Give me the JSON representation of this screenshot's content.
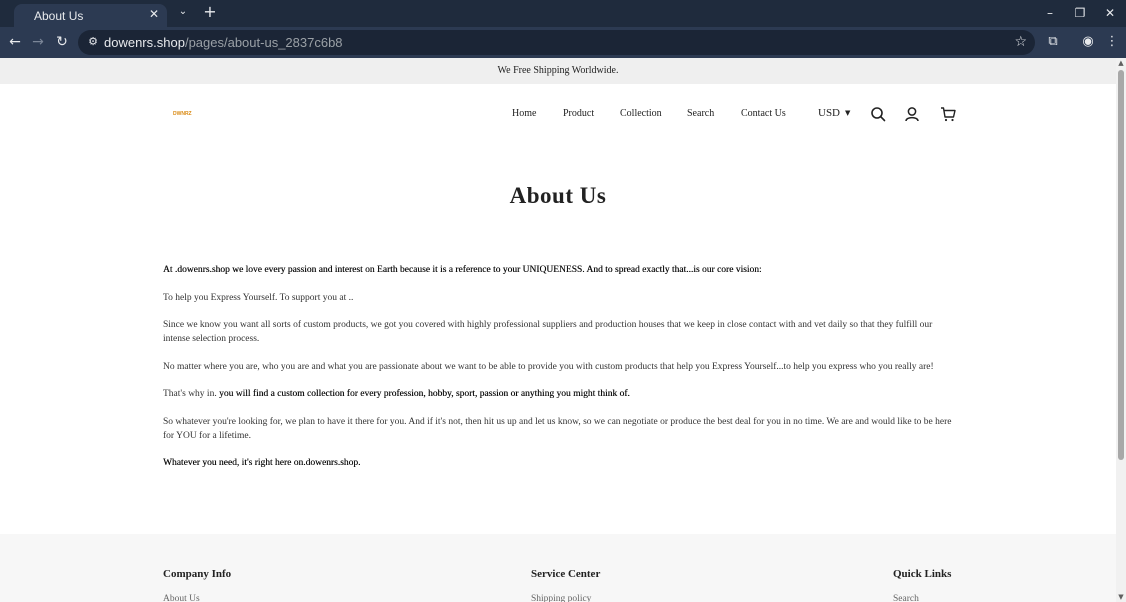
{
  "browser": {
    "tab_title": "About Us",
    "tab_close": "✕",
    "tab_menu": "⌄",
    "new_tab": "+",
    "url_host": "dowenrs.shop",
    "url_path": "/pages/about-us_2837c6b8",
    "window_controls": {
      "minimize": "–",
      "restore": "❐",
      "close": "✕"
    },
    "nav": {
      "back": "←",
      "forward": "→",
      "reload": "↻"
    },
    "icons": {
      "site_info": "site-info-icon",
      "bookmark": "star-icon",
      "extensions": "puzzle-icon",
      "profile": "account-icon",
      "menu": "kebab-menu-icon"
    },
    "glyphs": {
      "site_info": "⚙",
      "bookmark": "☆",
      "extensions": "⧉",
      "profile": "◉",
      "menu": "⋮"
    }
  },
  "announcement": "We Free Shipping Worldwide.",
  "header": {
    "logo_text": "DWNRZ",
    "nav": [
      {
        "label": "Home"
      },
      {
        "label": "Product"
      },
      {
        "label": "Collection"
      },
      {
        "label": "Search"
      },
      {
        "label": "Contact Us"
      }
    ],
    "currency": "USD",
    "currency_caret": "▼"
  },
  "page": {
    "title": "About Us",
    "paragraphs": [
      "At .dowenrs.shop we love every passion and interest on Earth because it is a reference to your UNIQUENESS. And to spread exactly that...is our core vision:",
      "To help you Express Yourself. To support you at ..",
      "Since we know you want all sorts of custom products, we got you covered with highly professional suppliers and production houses that we keep in close contact with and vet daily so that they fulfill our intense selection process.",
      "No matter where you are, who you are and what you are passionate about we want to be able to provide you with custom products that help you Express Yourself...to help you express who you really are!",
      "That's why in. ",
      "you will find a custom collection for every profession, hobby, sport, passion or anything you might think of.",
      "So whatever you're looking for, we plan to have it there for you. And if it's not, then hit us up and let us know, so we can negotiate or produce the best deal for you in no time. We are and would like to be here for YOU for a lifetime.",
      "Whatever you need, it's right here on.dowenrs.shop."
    ]
  },
  "footer": {
    "columns": [
      {
        "heading": "Company Info",
        "first_link": "About Us"
      },
      {
        "heading": "Service Center",
        "first_link": "Shipping policy"
      },
      {
        "heading": "Quick Links",
        "first_link": "Search"
      }
    ]
  },
  "scrollbar": {
    "up": "▲",
    "down": "▼"
  },
  "colors": {
    "tabbar": "#1f2b3d",
    "toolbar": "#2c3a52",
    "announcement_bg": "#efefef",
    "logo": "#d98a14",
    "footer_bg": "#f7f7f7"
  }
}
